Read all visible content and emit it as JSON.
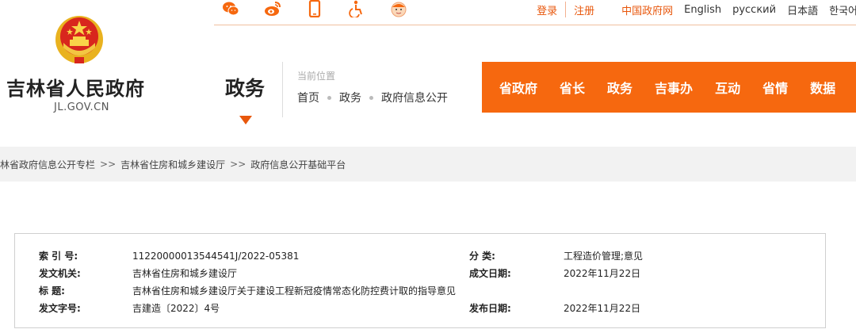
{
  "header": {
    "site_title": "吉林省人民政府",
    "site_domain": "JL.GOV.CN",
    "section_title": "政务",
    "location_label": "当前位置",
    "location_crumbs": [
      "首页",
      "政务",
      "政府信息公开"
    ]
  },
  "topbar": {
    "icons": [
      "weixin-icon",
      "weibo-icon",
      "mobile-icon",
      "accessibility-icon",
      "elder-mode-icon"
    ],
    "login": "登录",
    "register": "注册",
    "links": [
      "中国政府网",
      "English",
      "русский",
      "日本語",
      "한국어"
    ]
  },
  "nav": {
    "items": [
      "省政府",
      "省长",
      "政务",
      "吉事办",
      "互动",
      "省情",
      "数据"
    ]
  },
  "breadcrumb": {
    "items": [
      "林省政府信息公开专栏",
      "吉林省住房和城乡建设厅",
      "政府信息公开基础平台"
    ],
    "separator": ">>"
  },
  "info": {
    "index_label": "索 引 号:",
    "index_value": "11220000013544541J/2022-05381",
    "category_label": "分 类:",
    "category_value": "工程造价管理;意见",
    "issuer_label": "发文机关:",
    "issuer_value": "吉林省住房和城乡建设厅",
    "created_label": "成文日期:",
    "created_value": "2022年11月22日",
    "title_label": "标 题:",
    "title_value": "吉林省住房和城乡建设厅关于建设工程新冠疫情常态化防控费计取的指导意见",
    "docnum_label": "发文字号:",
    "docnum_value": "吉建造〔2022〕4号",
    "published_label": "发布日期:",
    "published_value": "2022年11月22日"
  },
  "colors": {
    "accent": "#f6680f",
    "emblem_gold": "#e9b21f",
    "emblem_red": "#d8261d"
  }
}
